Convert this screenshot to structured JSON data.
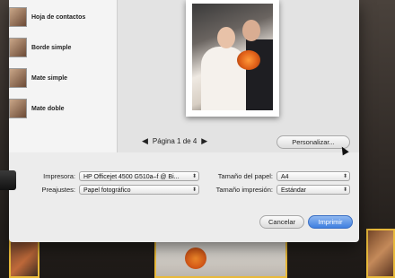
{
  "themes": [
    {
      "label": "Hoja de contactos"
    },
    {
      "label": "Borde simple"
    },
    {
      "label": "Mate simple"
    },
    {
      "label": "Mate doble"
    }
  ],
  "pager": {
    "label": "Página 1 de 4"
  },
  "buttons": {
    "customize": "Personalizar...",
    "cancel": "Cancelar",
    "print": "Imprimir"
  },
  "options": {
    "printer_label": "Impresora:",
    "printer_value": "HP Officejet 4500 G510a–f @ Bi...",
    "presets_label": "Preajustes:",
    "presets_value": "Papel fotográfico",
    "paper_size_label": "Tamaño del papel:",
    "paper_size_value": "A4",
    "print_size_label": "Tamaño impresión:",
    "print_size_value": "Estándar"
  },
  "icons": {
    "prev": "◀",
    "next": "▶",
    "chevron": "⬍"
  },
  "colors": {
    "accent": "#3f7fe0",
    "highlight_border": "#e8b93a"
  }
}
